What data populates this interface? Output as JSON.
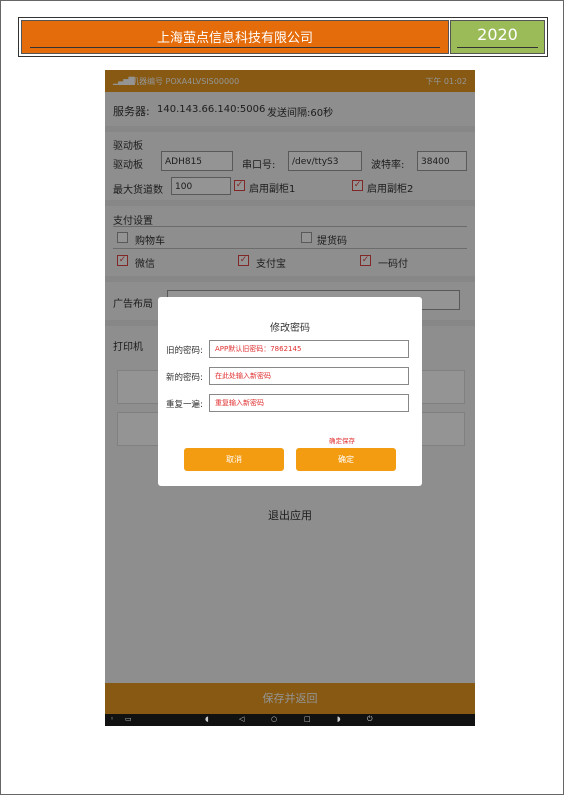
{
  "header": {
    "company": "上海萤点信息科技有限公司",
    "year": "2020"
  },
  "statusbar": {
    "signal_icon": "signal-icon",
    "device_id": "机器编号 POXA4LVSIS00000",
    "time": "下午 01:02"
  },
  "server": {
    "label": "服务器:",
    "address": "140.143.66.140:5006",
    "interval": "发送间隔:60秒"
  },
  "driver": {
    "section": "驱动板",
    "board_label": "驱动板",
    "board_value": "ADH815",
    "port_label": "串口号:",
    "port_value": "/dev/ttyS3",
    "baud_label": "波特率:",
    "baud_value": "38400",
    "max_label": "最大货道数",
    "max_value": "100",
    "sub1": "启用副柜1",
    "sub2": "启用副柜2"
  },
  "payment": {
    "section": "支付设置",
    "cart": "购物车",
    "pickup": "提货码",
    "wechat": "微信",
    "alipay": "支付宝",
    "onecode": "一码付"
  },
  "ads": {
    "label": "广告布局"
  },
  "printer": {
    "label": "打印机"
  },
  "exit_label": "退出应用",
  "save_label": "保存并返回",
  "dialog": {
    "title": "修改密码",
    "old_label": "旧的密码:",
    "old_value": "APP默认旧密码：7862145",
    "new_label": "新的密码:",
    "new_value": "在此处输入新密码",
    "repeat_label": "重复一遍:",
    "repeat_value": "重复输入新密码",
    "hint": "确定保存",
    "cancel": "取消",
    "confirm": "确定"
  },
  "colors": {
    "header_orange": "#e46c0a",
    "header_green": "#9bbb59",
    "app_orange": "#e89a1f",
    "button_orange": "#f39c12",
    "hint_red": "#e03030"
  }
}
